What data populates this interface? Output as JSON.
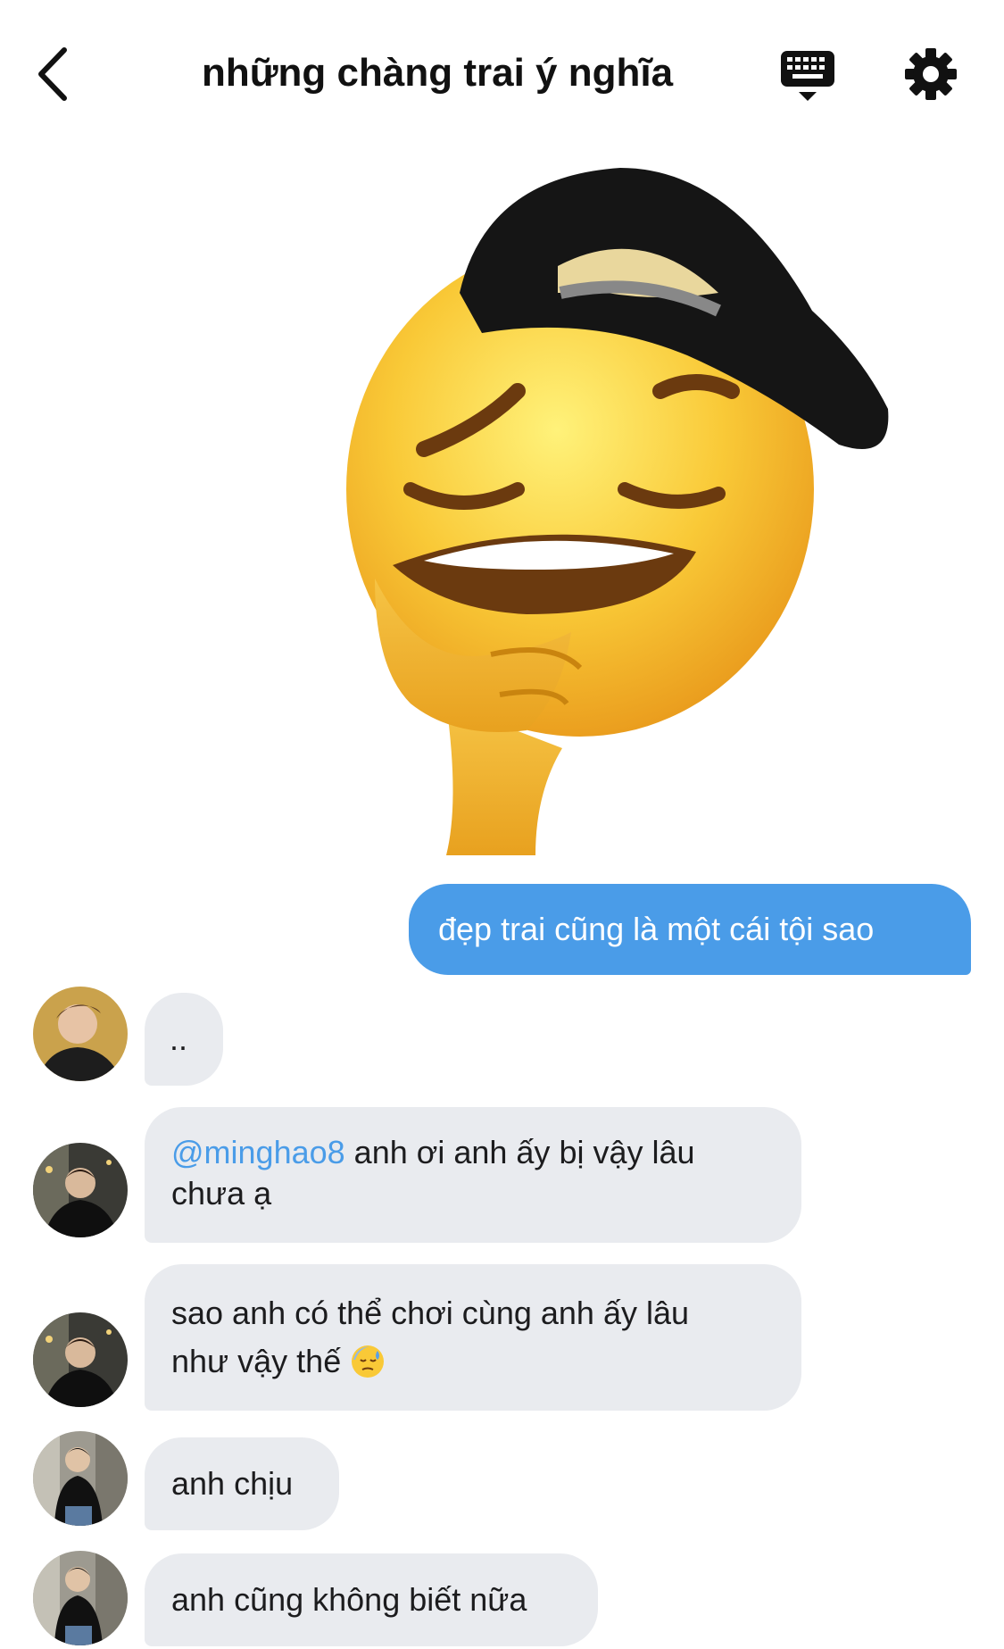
{
  "header": {
    "title": "những chàng trai ý nghĩa",
    "back_icon": "chevron-left-icon",
    "keyboard_icon": "keyboard-icon",
    "settings_icon": "gear-icon"
  },
  "sticker": {
    "name": "thinking-emoji-with-cap"
  },
  "messages": [
    {
      "direction": "out",
      "text": "đẹp trai cũng là một cái tội sao"
    },
    {
      "direction": "in",
      "text": ".."
    },
    {
      "direction": "in",
      "mention": "@minghao8",
      "text": " anh ơi anh ấy bị vậy lâu chưa ạ"
    },
    {
      "direction": "in",
      "line1": "sao anh có thể chơi cùng anh ấy lâu",
      "line2": "như vậy thế",
      "emoji": "sweat-face-emoji"
    },
    {
      "direction": "in",
      "text": "anh chịu"
    },
    {
      "direction": "in",
      "text": "anh cũng không biết nữa"
    }
  ],
  "colors": {
    "accent": "#4a9ce8",
    "incoming_bubble": "#e9ebef",
    "background": "#ffffff"
  }
}
